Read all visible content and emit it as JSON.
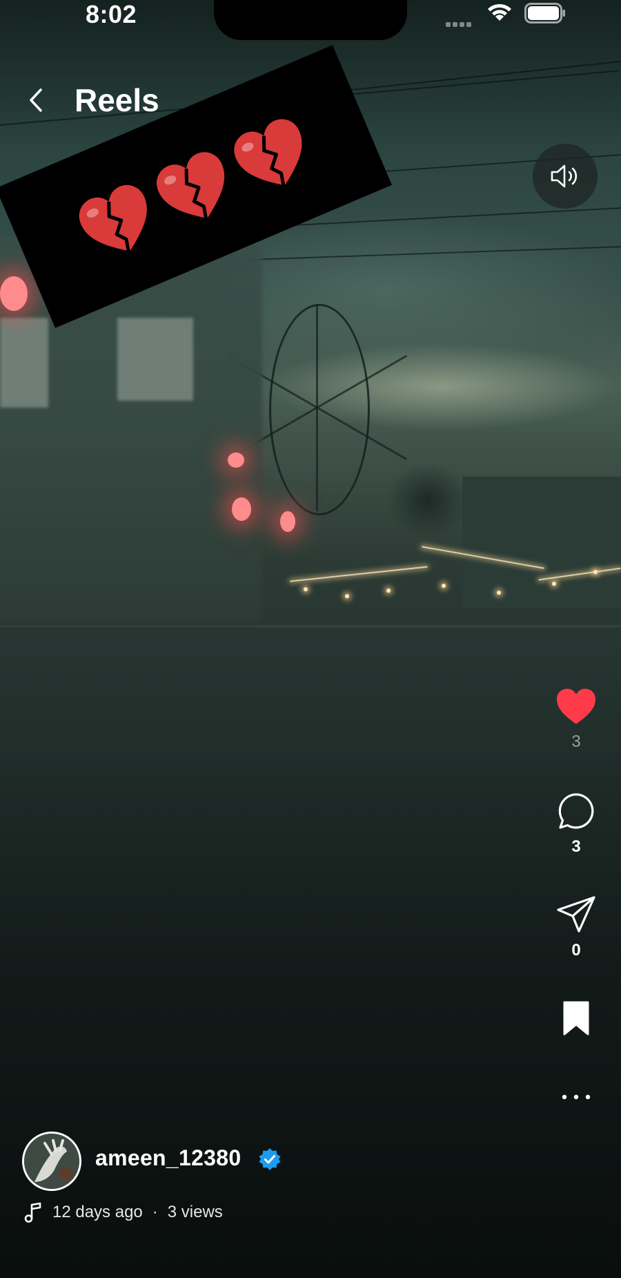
{
  "status_bar": {
    "time": "8:02"
  },
  "header": {
    "title": "Reels"
  },
  "sticker": {
    "emoji_name": "broken-heart",
    "count": 3,
    "color": "#d93a3a"
  },
  "actions": {
    "like": {
      "count": "3",
      "liked": true,
      "color": "#ff3b4a"
    },
    "comment": {
      "count": "3"
    },
    "share": {
      "count": "0"
    }
  },
  "post": {
    "username": "ameen_12380",
    "verified_color": "#1d9bf0",
    "age": "12 days ago",
    "separator": "·",
    "views": "3 views"
  }
}
